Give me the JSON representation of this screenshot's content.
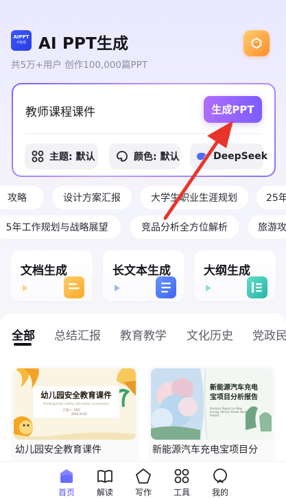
{
  "header": {
    "logo_text": "AIPPT",
    "logo_subtext": "AI生成",
    "title": "AI PPT生成",
    "subtitle": "共5万+用户 创作100,000篇PPT",
    "vip_icon": "diamond-icon"
  },
  "input_card": {
    "prompt": "教师课程课件",
    "generate_label": "生成PPT",
    "options": [
      {
        "label": "主题: 默认",
        "icon": "grid-icon"
      },
      {
        "label": "颜色: 默认",
        "icon": "palette-icon"
      },
      {
        "label": "DeepSeek",
        "icon": "deepseek-icon"
      }
    ]
  },
  "chips_row1": [
    "攻略",
    "设计方案汇报",
    "大学生职业生涯规划",
    "25年"
  ],
  "chips_row2": [
    "5年工作规划与战略展望",
    "竞品分析全方位解析",
    "旅游攻"
  ],
  "features": [
    {
      "label": "文档生成",
      "accent": "#ffb13b"
    },
    {
      "label": "长文本生成",
      "accent": "#4b7bff"
    },
    {
      "label": "大纲生成",
      "accent": "#35c7b8"
    }
  ],
  "tabs": [
    "全部",
    "总结汇报",
    "教育教学",
    "文化历史",
    "党政民"
  ],
  "templates": [
    {
      "name": "幼儿园安全教育课件",
      "title": "幼儿园安全教育课件",
      "caption": "Kindergarten safety education courseware",
      "presenter": "汇报人：XXX",
      "date": "202X.03.01"
    },
    {
      "name": "新能源汽车充电宝项目分",
      "title_line1": "新能源汽车充电",
      "title_line2": "宝项目分析报告",
      "caption": "Analysis Report on New Energy Vehicle Power Bank Project"
    }
  ],
  "nav": [
    {
      "label": "首页",
      "icon": "home-icon",
      "active": true
    },
    {
      "label": "解读",
      "icon": "book-icon",
      "active": false
    },
    {
      "label": "写作",
      "icon": "pentagon-icon",
      "active": false
    },
    {
      "label": "工具",
      "icon": "tools-grid-icon",
      "active": false
    },
    {
      "label": "我的",
      "icon": "profile-icon",
      "active": false
    }
  ],
  "colors": {
    "accent": "#7c5cff",
    "annotation_arrow": "#e8352b"
  }
}
